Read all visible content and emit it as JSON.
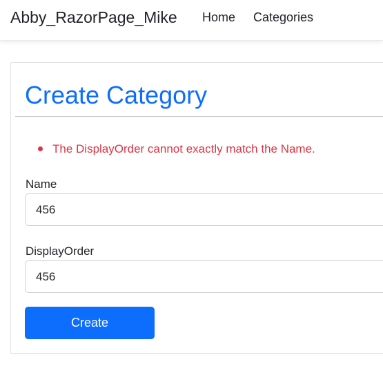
{
  "navbar": {
    "brand": "Abby_RazorPage_Mike",
    "links": [
      {
        "label": "Home"
      },
      {
        "label": "Categories"
      }
    ]
  },
  "page": {
    "title": "Create Category",
    "validation_errors": [
      "The DisplayOrder cannot exactly match the Name."
    ]
  },
  "form": {
    "name": {
      "label": "Name",
      "value": "456"
    },
    "display_order": {
      "label": "DisplayOrder",
      "value": "456"
    },
    "submit_label": "Create"
  },
  "colors": {
    "primary": "#0d6efd",
    "danger": "#dc3545"
  }
}
